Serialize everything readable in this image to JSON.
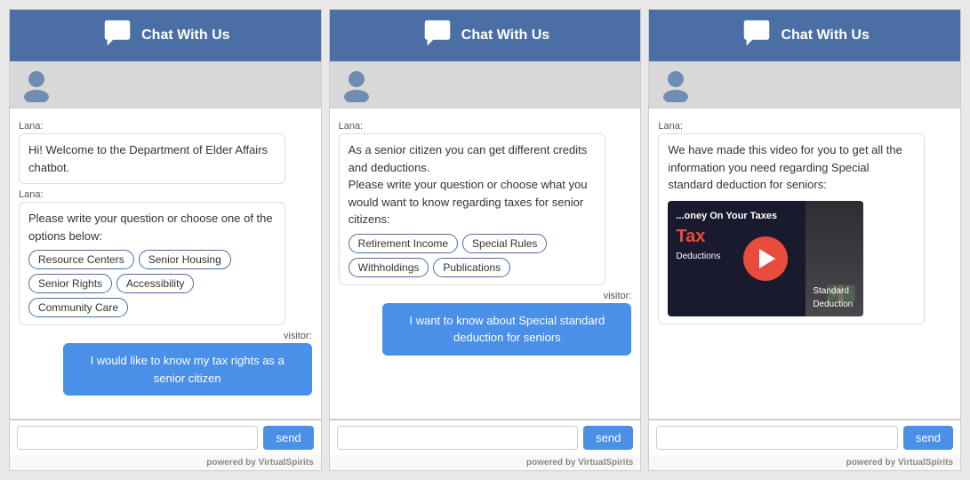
{
  "header": {
    "title": "Chat With Us"
  },
  "widget1": {
    "sender1": "Lana:",
    "message1": "Hi! Welcome to the Department of Elder Affairs chatbot.",
    "sender2": "Lana:",
    "message2": "Please write your question or choose one of the options below:",
    "options": [
      "Resource Centers",
      "Senior Housing",
      "Senior Rights",
      "Accessibility",
      "Community Care"
    ],
    "visitor_label": "visitor:",
    "visitor_message": "I would like to know my tax rights as a senior citizen"
  },
  "widget2": {
    "sender1": "Lana:",
    "message1": "As a senior citizen you can get different credits and deductions.\nPlease write your question or choose what you would want to know regarding taxes for senior citizens:",
    "options": [
      "Retirement Income",
      "Special Rules",
      "Withholdings",
      "Publications"
    ],
    "visitor_label": "visitor:",
    "visitor_message": "I want to know about Special standard deduction for seniors"
  },
  "widget3": {
    "sender1": "Lana:",
    "message1": "We have made this video for you to get all the information you need regarding Special standard deduction for seniors:",
    "video": {
      "overlay_text": "...oney On Your Taxes",
      "tax_text": "Tax",
      "deductions_text": "Deductions"
    }
  },
  "footer": {
    "powered_by": "powered by",
    "brand": "VirtualSpirits"
  },
  "input": {
    "placeholder": "",
    "send_label": "send"
  }
}
